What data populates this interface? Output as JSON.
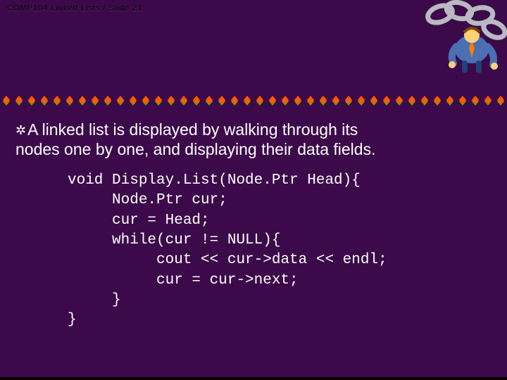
{
  "header": "COMP104 Linked Lists / Slide 21",
  "body": {
    "bullet_glyph": "✲",
    "text_line1": "A linked list is displayed by walking through its",
    "text_line2": "nodes one by one, and displaying their data fields."
  },
  "code": {
    "l1": "void Display.List(Node.Ptr Head){",
    "l2": "     Node.Ptr cur;",
    "l3": "     cur = Head;",
    "l4": "     while(cur != NULL){",
    "l5": "          cout << cur->data << endl;",
    "l6": "          cur = cur->next;",
    "l7": "     }",
    "l8": "}"
  }
}
